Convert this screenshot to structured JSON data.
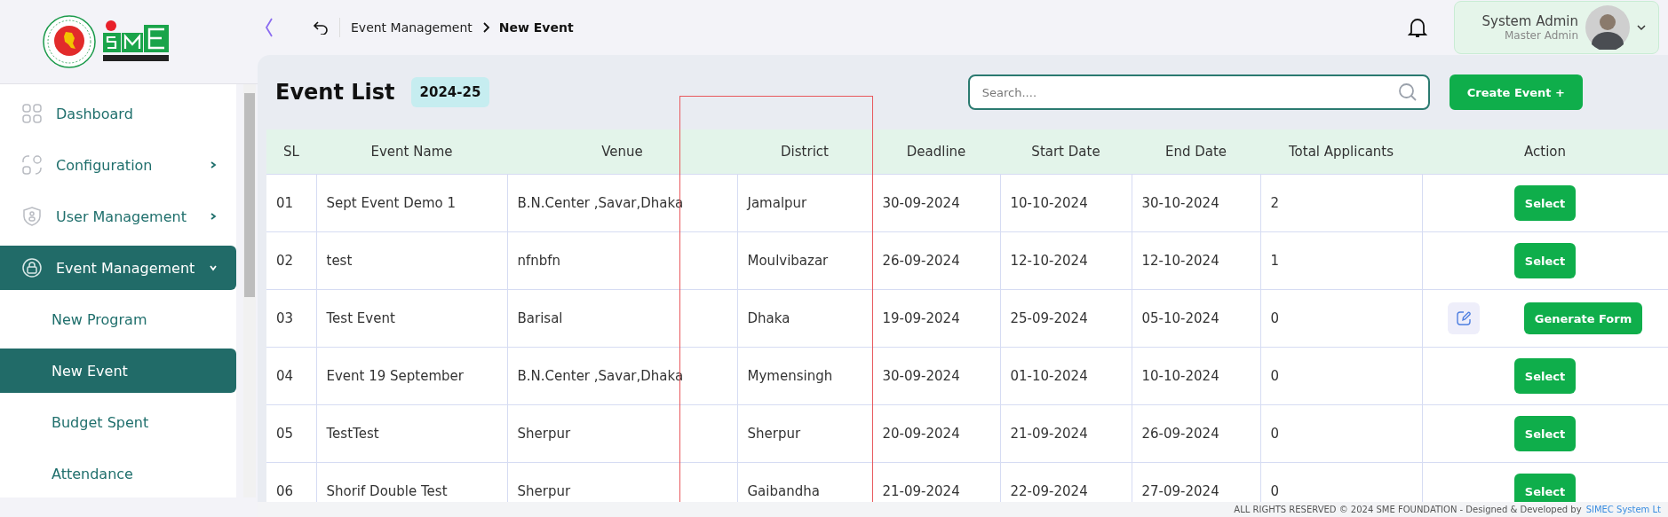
{
  "breadcrumb": {
    "parent": "Event Management",
    "current": "New Event"
  },
  "user": {
    "name": "System Admin",
    "role": "Master Admin"
  },
  "sidebar": {
    "items": [
      {
        "label": "Dashboard",
        "kind": "grid",
        "selected": false
      },
      {
        "label": "Configuration",
        "kind": "config",
        "selected": false,
        "expanded": false
      },
      {
        "label": "User Management",
        "kind": "shield",
        "selected": false,
        "expanded": false
      },
      {
        "label": "Event Management",
        "kind": "lock",
        "selected": true,
        "expanded": true,
        "children": [
          {
            "label": "New Program",
            "selected": false
          },
          {
            "label": "New Event",
            "selected": true
          },
          {
            "label": "Budget Spent",
            "selected": false
          },
          {
            "label": "Attendance",
            "selected": false
          }
        ]
      }
    ]
  },
  "page": {
    "title": "Event List",
    "year": "2024-25",
    "search": {
      "placeholder": "Search...."
    },
    "create_button": "Create Event +"
  },
  "table": {
    "columns": [
      "SL",
      "Event Name",
      "Venue",
      "District",
      "Deadline",
      "Start Date",
      "End Date",
      "Total Applicants",
      "Action"
    ],
    "rows": [
      {
        "cells": [
          "01",
          "Sept Event Demo 1",
          "B.N.Center ,Savar,Dhaka",
          "Jamalpur",
          "30-09-2024",
          "10-10-2024",
          "30-10-2024",
          "2"
        ],
        "action": {
          "kind": "select",
          "label": "Select"
        }
      },
      {
        "cells": [
          "02",
          "test",
          "nfnbfn",
          "Moulvibazar",
          "26-09-2024",
          "12-10-2024",
          "12-10-2024",
          "1"
        ],
        "action": {
          "kind": "select",
          "label": "Select"
        }
      },
      {
        "cells": [
          "03",
          "Test Event",
          "Barisal",
          "Dhaka",
          "19-09-2024",
          "25-09-2024",
          "05-10-2024",
          "0"
        ],
        "action": {
          "kind": "generate",
          "label": "Generate Form"
        }
      },
      {
        "cells": [
          "04",
          "Event 19 September",
          "B.N.Center ,Savar,Dhaka",
          "Mymensingh",
          "30-09-2024",
          "01-10-2024",
          "10-10-2024",
          "0"
        ],
        "action": {
          "kind": "select",
          "label": "Select"
        }
      },
      {
        "cells": [
          "05",
          "TestTest",
          "Sherpur",
          "Sherpur",
          "20-09-2024",
          "21-09-2024",
          "26-09-2024",
          "0"
        ],
        "action": {
          "kind": "select",
          "label": "Select"
        }
      },
      {
        "cells": [
          "06",
          "Shorif Double Test",
          "Sherpur",
          "Gaibandha",
          "21-09-2024",
          "22-09-2024",
          "27-09-2024",
          "0"
        ],
        "action": {
          "kind": "select",
          "label": "Select"
        }
      }
    ]
  },
  "footer": {
    "text": "ALL RIGHTS RESERVED © 2024 SME FOUNDATION - Designed & Developed by",
    "link": "SIMEC System Lt"
  }
}
